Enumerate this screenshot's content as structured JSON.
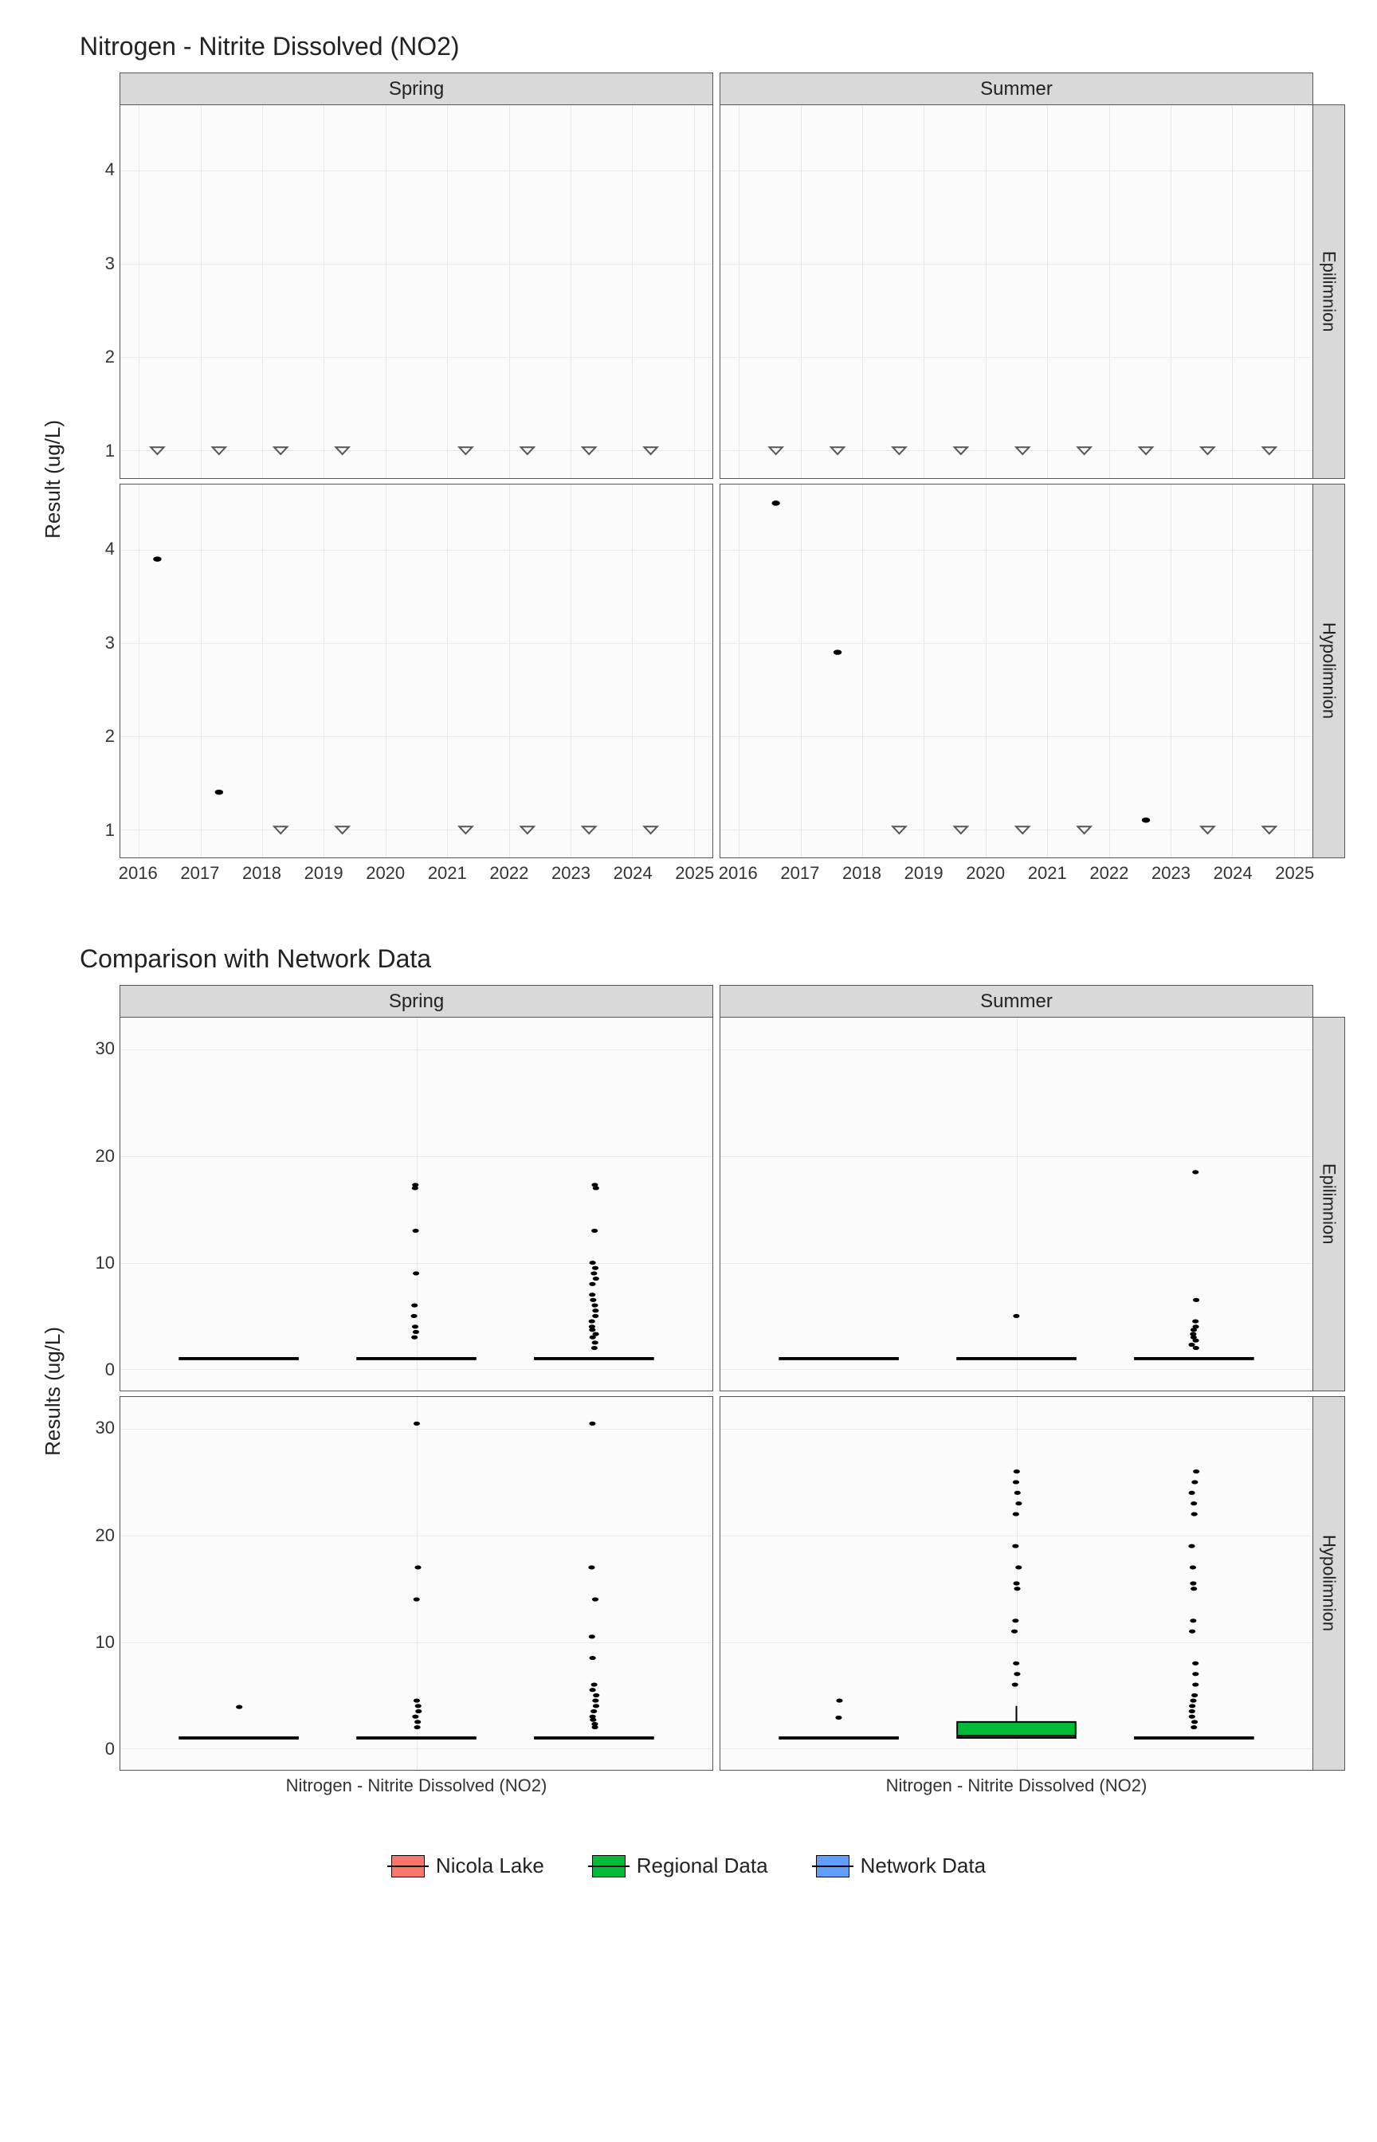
{
  "chart_data": [
    {
      "id": "timeseries",
      "title": "Nitrogen - Nitrite Dissolved (NO2)",
      "ylabel": "Result (ug/L)",
      "type": "scatter",
      "x_range": [
        2015.7,
        2025.3
      ],
      "y_range": [
        0.7,
        4.7
      ],
      "y_ticks": [
        1,
        2,
        3,
        4
      ],
      "x_ticks": [
        2016,
        2017,
        2018,
        2019,
        2020,
        2021,
        2022,
        2023,
        2024,
        2025
      ],
      "col_facets": [
        "Spring",
        "Summer"
      ],
      "row_facets": [
        "Epilimnion",
        "Hypolimnion"
      ],
      "note": "shape 'tri' = below detection (open triangle), 'dot' = measured",
      "panels": {
        "Spring|Epilimnion": {
          "points": [
            {
              "x": 2016.3,
              "y": 1,
              "shape": "tri"
            },
            {
              "x": 2017.3,
              "y": 1,
              "shape": "tri"
            },
            {
              "x": 2018.3,
              "y": 1,
              "shape": "tri"
            },
            {
              "x": 2019.3,
              "y": 1,
              "shape": "tri"
            },
            {
              "x": 2021.3,
              "y": 1,
              "shape": "tri"
            },
            {
              "x": 2022.3,
              "y": 1,
              "shape": "tri"
            },
            {
              "x": 2023.3,
              "y": 1,
              "shape": "tri"
            },
            {
              "x": 2024.3,
              "y": 1,
              "shape": "tri"
            }
          ]
        },
        "Summer|Epilimnion": {
          "points": [
            {
              "x": 2016.6,
              "y": 1,
              "shape": "tri"
            },
            {
              "x": 2017.6,
              "y": 1,
              "shape": "tri"
            },
            {
              "x": 2018.6,
              "y": 1,
              "shape": "tri"
            },
            {
              "x": 2019.6,
              "y": 1,
              "shape": "tri"
            },
            {
              "x": 2020.6,
              "y": 1,
              "shape": "tri"
            },
            {
              "x": 2021.6,
              "y": 1,
              "shape": "tri"
            },
            {
              "x": 2022.6,
              "y": 1,
              "shape": "tri"
            },
            {
              "x": 2023.6,
              "y": 1,
              "shape": "tri"
            },
            {
              "x": 2024.6,
              "y": 1,
              "shape": "tri"
            }
          ]
        },
        "Spring|Hypolimnion": {
          "points": [
            {
              "x": 2016.3,
              "y": 3.9,
              "shape": "dot"
            },
            {
              "x": 2017.3,
              "y": 1.4,
              "shape": "dot"
            },
            {
              "x": 2018.3,
              "y": 1,
              "shape": "tri"
            },
            {
              "x": 2019.3,
              "y": 1,
              "shape": "tri"
            },
            {
              "x": 2021.3,
              "y": 1,
              "shape": "tri"
            },
            {
              "x": 2022.3,
              "y": 1,
              "shape": "tri"
            },
            {
              "x": 2023.3,
              "y": 1,
              "shape": "tri"
            },
            {
              "x": 2024.3,
              "y": 1,
              "shape": "tri"
            }
          ]
        },
        "Summer|Hypolimnion": {
          "points": [
            {
              "x": 2016.6,
              "y": 4.5,
              "shape": "dot"
            },
            {
              "x": 2017.6,
              "y": 2.9,
              "shape": "dot"
            },
            {
              "x": 2018.6,
              "y": 1,
              "shape": "tri"
            },
            {
              "x": 2019.6,
              "y": 1,
              "shape": "tri"
            },
            {
              "x": 2020.6,
              "y": 1,
              "shape": "tri"
            },
            {
              "x": 2021.6,
              "y": 1,
              "shape": "tri"
            },
            {
              "x": 2022.6,
              "y": 1.1,
              "shape": "dot"
            },
            {
              "x": 2023.6,
              "y": 1,
              "shape": "tri"
            },
            {
              "x": 2024.6,
              "y": 1,
              "shape": "tri"
            }
          ]
        }
      }
    },
    {
      "id": "boxcompare",
      "title": "Comparison with Network Data",
      "ylabel": "Results (ug/L)",
      "xlabel": "Nitrogen - Nitrite Dissolved (NO2)",
      "type": "box",
      "y_range": [
        -2,
        33
      ],
      "y_ticks": [
        0,
        10,
        20,
        30
      ],
      "col_facets": [
        "Spring",
        "Summer"
      ],
      "row_facets": [
        "Epilimnion",
        "Hypolimnion"
      ],
      "groups": [
        "Nicola Lake",
        "Regional Data",
        "Network Data"
      ],
      "group_colors": {
        "Nicola Lake": "#F8766D",
        "Regional Data": "#00BA38",
        "Network Data": "#619CFF"
      },
      "panels": {
        "Spring|Epilimnion": {
          "boxes": [
            {
              "group": "Nicola Lake",
              "min": 1,
              "q1": 1,
              "med": 1,
              "q3": 1,
              "max": 1,
              "out": []
            },
            {
              "group": "Regional Data",
              "min": 1,
              "q1": 1,
              "med": 1,
              "q3": 1,
              "max": 1,
              "out": [
                3,
                3.5,
                4,
                5,
                6,
                9,
                13,
                17,
                17.3
              ]
            },
            {
              "group": "Network Data",
              "min": 1,
              "q1": 1,
              "med": 1,
              "q3": 1,
              "max": 1,
              "out": [
                2,
                2.5,
                3,
                3.3,
                3.7,
                4,
                4.5,
                5,
                5.5,
                6,
                6.5,
                7,
                8,
                8.5,
                9,
                9.5,
                10,
                13,
                17,
                17.3
              ]
            }
          ]
        },
        "Summer|Epilimnion": {
          "boxes": [
            {
              "group": "Nicola Lake",
              "min": 1,
              "q1": 1,
              "med": 1,
              "q3": 1,
              "max": 1,
              "out": []
            },
            {
              "group": "Regional Data",
              "min": 1,
              "q1": 1,
              "med": 1,
              "q3": 1,
              "max": 1,
              "out": [
                5
              ]
            },
            {
              "group": "Network Data",
              "min": 1,
              "q1": 1,
              "med": 1,
              "q3": 1,
              "max": 1,
              "out": [
                2,
                2.3,
                2.7,
                3,
                3.3,
                3.7,
                4,
                4.5,
                6.5,
                18.5
              ]
            }
          ]
        },
        "Spring|Hypolimnion": {
          "boxes": [
            {
              "group": "Nicola Lake",
              "min": 1,
              "q1": 1,
              "med": 1,
              "q3": 1,
              "max": 1,
              "out": [
                3.9
              ]
            },
            {
              "group": "Regional Data",
              "min": 1,
              "q1": 1,
              "med": 1,
              "q3": 1,
              "max": 1,
              "out": [
                2,
                2.5,
                3,
                3.5,
                4,
                4.5,
                14,
                17,
                30.5
              ]
            },
            {
              "group": "Network Data",
              "min": 1,
              "q1": 1,
              "med": 1,
              "q3": 1,
              "max": 1,
              "out": [
                2,
                2.3,
                2.7,
                3,
                3.5,
                4,
                4.5,
                5,
                5.5,
                6,
                8.5,
                10.5,
                14,
                17,
                30.5
              ]
            }
          ]
        },
        "Summer|Hypolimnion": {
          "boxes": [
            {
              "group": "Nicola Lake",
              "min": 1,
              "q1": 1,
              "med": 1,
              "q3": 1,
              "max": 1,
              "out": [
                2.9,
                4.5
              ]
            },
            {
              "group": "Regional Data",
              "min": 1,
              "q1": 1,
              "med": 1.2,
              "q3": 2.5,
              "max": 4,
              "out": [
                6,
                7,
                8,
                11,
                12,
                15,
                15.5,
                17,
                19,
                22,
                23,
                24,
                25,
                26
              ]
            },
            {
              "group": "Network Data",
              "min": 1,
              "q1": 1,
              "med": 1,
              "q3": 1,
              "max": 1,
              "out": [
                2,
                2.5,
                3,
                3.5,
                4,
                4.5,
                5,
                6,
                7,
                8,
                11,
                12,
                15,
                15.5,
                17,
                19,
                22,
                23,
                24,
                25,
                26
              ]
            }
          ]
        }
      }
    }
  ],
  "legend": {
    "items": [
      {
        "label": "Nicola Lake",
        "color": "#F8766D"
      },
      {
        "label": "Regional Data",
        "color": "#00BA38"
      },
      {
        "label": "Network Data",
        "color": "#619CFF"
      }
    ]
  }
}
